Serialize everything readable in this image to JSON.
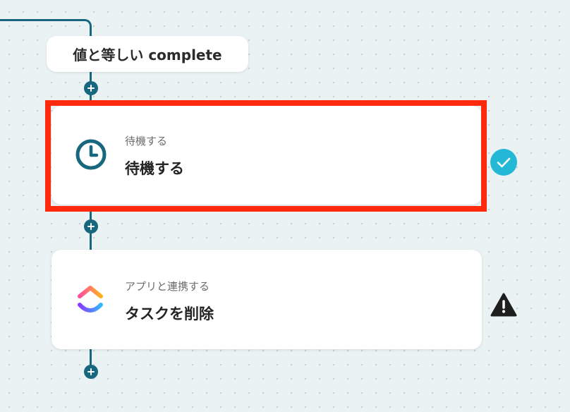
{
  "condition_pill": {
    "label": "値と等しい complete"
  },
  "steps": [
    {
      "subtitle": "待機する",
      "title": "待機する",
      "icon": "clock-icon",
      "status": "success"
    },
    {
      "subtitle": "アプリと連携する",
      "title": "タスクを削除",
      "icon": "clickup-logo-icon",
      "status": "warning"
    }
  ],
  "colors": {
    "connector": "#17677e",
    "highlight": "#ff2a0d",
    "success": "#22b8d6",
    "warning": "#1e1e1e"
  }
}
